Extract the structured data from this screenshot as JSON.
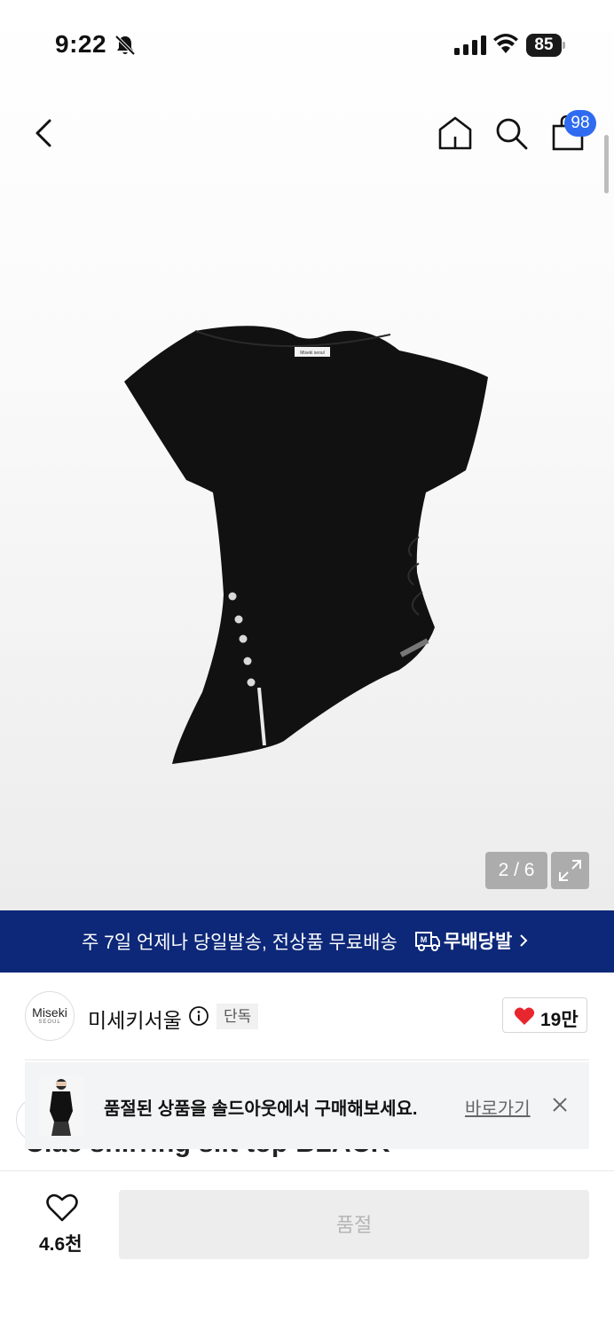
{
  "status_bar": {
    "time": "9:22",
    "battery": "85"
  },
  "nav": {
    "cart_count": "98"
  },
  "gallery": {
    "pager": "2 / 6",
    "tag_text": "Miseki seoul"
  },
  "banner": {
    "text": "주 7일 언제나 당일발송, 전상품 무료배송",
    "service_name": "무배당발"
  },
  "brand": {
    "logo_line1": "Miseki",
    "logo_line2": "SEOUL",
    "name": "미세키서울",
    "badge": "단독",
    "likes": "19만"
  },
  "product": {
    "title_peek": "C.ae shirring slit top BLACK"
  },
  "toast": {
    "message": "품절된 상품을 솔드아웃에서 구매해보세요.",
    "link": "바로가기"
  },
  "bottom": {
    "wish_count": "4.6천",
    "buy_button": "품절"
  },
  "colors": {
    "banner_bg": "#0d2878",
    "badge_blue": "#2f6bf0",
    "heart_red": "#e8262d"
  }
}
